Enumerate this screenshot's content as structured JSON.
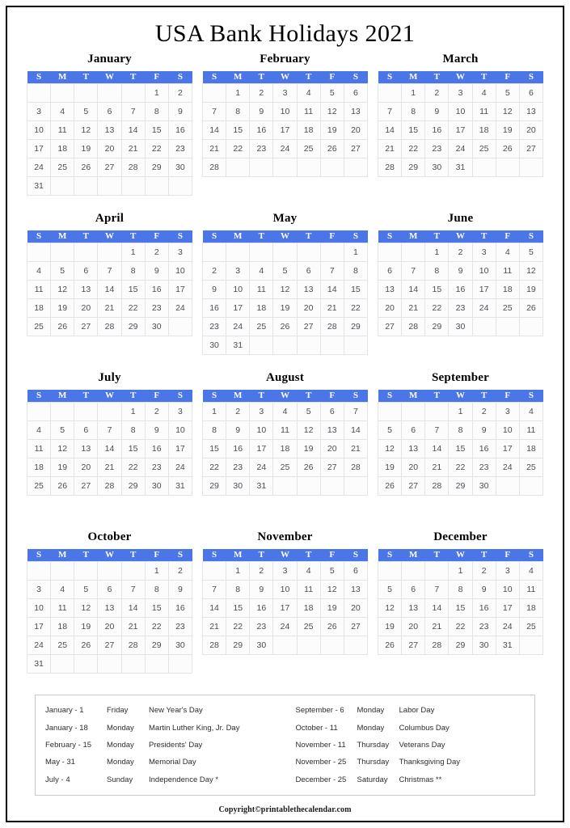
{
  "title": "USA Bank Holidays 2021",
  "weekday_headers": [
    "S",
    "M",
    "T",
    "W",
    "T",
    "F",
    "S"
  ],
  "colors": {
    "header_blue": "#4a76e8",
    "header_text": "#ffffff",
    "day_text": "#4c4c55",
    "cell_border": "#e4e4e6",
    "page_border": "#000000",
    "legend_border": "#c9c9c9"
  },
  "months": [
    {
      "name": "January",
      "weeks": [
        [
          "",
          "",
          "",
          "",
          "",
          "1",
          "2"
        ],
        [
          "3",
          "4",
          "5",
          "6",
          "7",
          "8",
          "9"
        ],
        [
          "10",
          "11",
          "12",
          "13",
          "14",
          "15",
          "16"
        ],
        [
          "17",
          "18",
          "19",
          "20",
          "21",
          "22",
          "23"
        ],
        [
          "24",
          "25",
          "26",
          "27",
          "28",
          "29",
          "30"
        ],
        [
          "31",
          "",
          "",
          "",
          "",
          "",
          ""
        ]
      ]
    },
    {
      "name": "February",
      "weeks": [
        [
          "",
          "1",
          "2",
          "3",
          "4",
          "5",
          "6"
        ],
        [
          "7",
          "8",
          "9",
          "10",
          "11",
          "12",
          "13"
        ],
        [
          "14",
          "15",
          "16",
          "17",
          "18",
          "19",
          "20"
        ],
        [
          "21",
          "22",
          "23",
          "24",
          "25",
          "26",
          "27"
        ],
        [
          "28",
          "",
          "",
          "",
          "",
          "",
          ""
        ]
      ]
    },
    {
      "name": "March",
      "weeks": [
        [
          "",
          "1",
          "2",
          "3",
          "4",
          "5",
          "6"
        ],
        [
          "7",
          "8",
          "9",
          "10",
          "11",
          "12",
          "13"
        ],
        [
          "14",
          "15",
          "16",
          "17",
          "18",
          "19",
          "20"
        ],
        [
          "21",
          "22",
          "23",
          "24",
          "25",
          "26",
          "27"
        ],
        [
          "28",
          "29",
          "30",
          "31",
          "",
          "",
          ""
        ]
      ]
    },
    {
      "name": "April",
      "weeks": [
        [
          "",
          "",
          "",
          "",
          "1",
          "2",
          "3"
        ],
        [
          "4",
          "5",
          "6",
          "7",
          "8",
          "9",
          "10"
        ],
        [
          "11",
          "12",
          "13",
          "14",
          "15",
          "16",
          "17"
        ],
        [
          "18",
          "19",
          "20",
          "21",
          "22",
          "23",
          "24"
        ],
        [
          "25",
          "26",
          "27",
          "28",
          "29",
          "30",
          ""
        ]
      ]
    },
    {
      "name": "May",
      "weeks": [
        [
          "",
          "",
          "",
          "",
          "",
          "",
          "1"
        ],
        [
          "2",
          "3",
          "4",
          "5",
          "6",
          "7",
          "8"
        ],
        [
          "9",
          "10",
          "11",
          "12",
          "13",
          "14",
          "15"
        ],
        [
          "16",
          "17",
          "18",
          "19",
          "20",
          "21",
          "22"
        ],
        [
          "23",
          "24",
          "25",
          "26",
          "27",
          "28",
          "29"
        ],
        [
          "30",
          "31",
          "",
          "",
          "",
          "",
          ""
        ]
      ]
    },
    {
      "name": "June",
      "weeks": [
        [
          "",
          "",
          "1",
          "2",
          "3",
          "4",
          "5"
        ],
        [
          "6",
          "7",
          "8",
          "9",
          "10",
          "11",
          "12"
        ],
        [
          "13",
          "14",
          "15",
          "16",
          "17",
          "18",
          "19"
        ],
        [
          "20",
          "21",
          "22",
          "23",
          "24",
          "25",
          "26"
        ],
        [
          "27",
          "28",
          "29",
          "30",
          "",
          "",
          ""
        ]
      ]
    },
    {
      "name": "July",
      "weeks": [
        [
          "",
          "",
          "",
          "",
          "1",
          "2",
          "3"
        ],
        [
          "4",
          "5",
          "6",
          "7",
          "8",
          "9",
          "10"
        ],
        [
          "11",
          "12",
          "13",
          "14",
          "15",
          "16",
          "17"
        ],
        [
          "18",
          "19",
          "20",
          "21",
          "22",
          "23",
          "24"
        ],
        [
          "25",
          "26",
          "27",
          "28",
          "29",
          "30",
          "31"
        ]
      ]
    },
    {
      "name": "August",
      "weeks": [
        [
          "1",
          "2",
          "3",
          "4",
          "5",
          "6",
          "7"
        ],
        [
          "8",
          "9",
          "10",
          "11",
          "12",
          "13",
          "14"
        ],
        [
          "15",
          "16",
          "17",
          "18",
          "19",
          "20",
          "21"
        ],
        [
          "22",
          "23",
          "24",
          "25",
          "26",
          "27",
          "28"
        ],
        [
          "29",
          "30",
          "31",
          "",
          "",
          "",
          ""
        ]
      ]
    },
    {
      "name": "September",
      "weeks": [
        [
          "",
          "",
          "",
          "1",
          "2",
          "3",
          "4"
        ],
        [
          "5",
          "6",
          "7",
          "8",
          "9",
          "10",
          "11"
        ],
        [
          "12",
          "13",
          "14",
          "15",
          "16",
          "17",
          "18"
        ],
        [
          "19",
          "20",
          "21",
          "22",
          "23",
          "24",
          "25"
        ],
        [
          "26",
          "27",
          "28",
          "29",
          "30",
          "",
          ""
        ]
      ]
    },
    {
      "name": "October",
      "weeks": [
        [
          "",
          "",
          "",
          "",
          "",
          "1",
          "2"
        ],
        [
          "3",
          "4",
          "5",
          "6",
          "7",
          "8",
          "9"
        ],
        [
          "10",
          "11",
          "12",
          "13",
          "14",
          "15",
          "16"
        ],
        [
          "17",
          "18",
          "19",
          "20",
          "21",
          "22",
          "23"
        ],
        [
          "24",
          "25",
          "26",
          "27",
          "28",
          "29",
          "30"
        ],
        [
          "31",
          "",
          "",
          "",
          "",
          "",
          ""
        ]
      ]
    },
    {
      "name": "November",
      "weeks": [
        [
          "",
          "1",
          "2",
          "3",
          "4",
          "5",
          "6"
        ],
        [
          "7",
          "8",
          "9",
          "10",
          "11",
          "12",
          "13"
        ],
        [
          "14",
          "15",
          "16",
          "17",
          "18",
          "19",
          "20"
        ],
        [
          "21",
          "22",
          "23",
          "24",
          "25",
          "26",
          "27"
        ],
        [
          "28",
          "29",
          "30",
          "",
          "",
          "",
          ""
        ]
      ]
    },
    {
      "name": "December",
      "weeks": [
        [
          "",
          "",
          "",
          "1",
          "2",
          "3",
          "4"
        ],
        [
          "5",
          "6",
          "7",
          "8",
          "9",
          "10",
          "11"
        ],
        [
          "12",
          "13",
          "14",
          "15",
          "16",
          "17",
          "18"
        ],
        [
          "19",
          "20",
          "21",
          "22",
          "23",
          "24",
          "25"
        ],
        [
          "26",
          "27",
          "28",
          "29",
          "30",
          "31",
          ""
        ]
      ]
    }
  ],
  "legend": {
    "left": [
      {
        "date": "January - 1",
        "day": "Friday",
        "name": "New Year's Day"
      },
      {
        "date": "January - 18",
        "day": "Monday",
        "name": "Martin Luther King, Jr. Day"
      },
      {
        "date": "February - 15",
        "day": "Monday",
        "name": "Presidents' Day"
      },
      {
        "date": "May - 31",
        "day": "Monday",
        "name": "Memorial Day"
      },
      {
        "date": "July - 4",
        "day": "Sunday",
        "name": "Independence Day *"
      }
    ],
    "right": [
      {
        "date": "September - 6",
        "day": "Monday",
        "name": "Labor Day"
      },
      {
        "date": "October - 11",
        "day": "Monday",
        "name": "Columbus Day"
      },
      {
        "date": "November - 11",
        "day": "Thursday",
        "name": "Veterans Day"
      },
      {
        "date": "November - 25",
        "day": "Thursday",
        "name": "Thanksgiving Day"
      },
      {
        "date": "December - 25",
        "day": "Saturday",
        "name": "Christmas **"
      }
    ]
  },
  "copyright": "Copyright©printablethecalendar.com"
}
